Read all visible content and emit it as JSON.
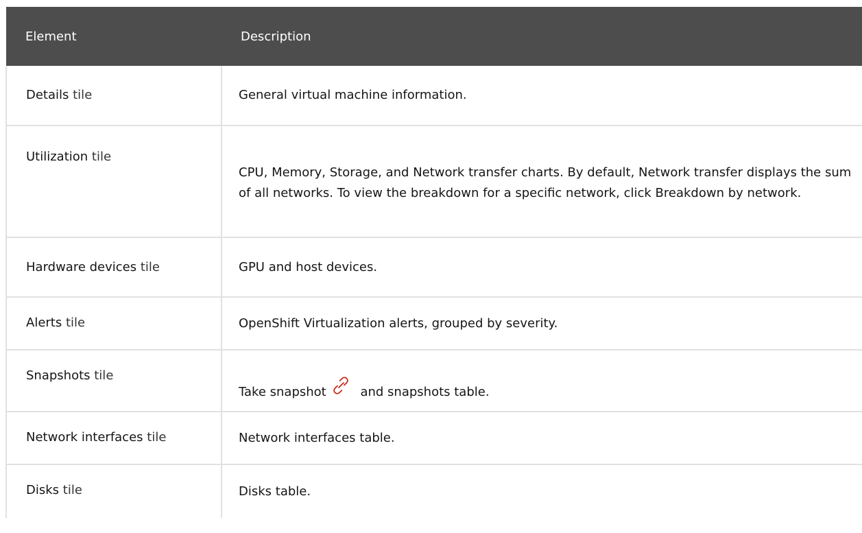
{
  "table": {
    "headers": [
      "Element",
      "Description"
    ],
    "rows": [
      {
        "name": "Details",
        "suffix": " tile",
        "desc": {
          "text": "General virtual machine information."
        }
      },
      {
        "name": "Utilization",
        "suffix": " tile",
        "desc": {
          "cpu": "CPU",
          "sep1": ", ",
          "memory": "Memory",
          "sep2": ", ",
          "storage": "Storage",
          "sep3": ", and ",
          "network_transfer": "Network transfer",
          "text1": " charts. By default, ",
          "network_transfer_2": "Network transfer",
          "text2": " displays the sum of all networks. To view the breakdown for a specific network, click ",
          "breakdown": "Breakdown by network",
          "text3": "."
        }
      },
      {
        "name": "Hardware devices",
        "suffix": " tile",
        "desc": {
          "text": "GPU and host devices."
        }
      },
      {
        "name": "Alerts",
        "suffix": " tile",
        "desc": {
          "text": "OpenShift Virtualization alerts, grouped by severity."
        }
      },
      {
        "name": "Snapshots",
        "suffix": " tile",
        "desc": {
          "take_snapshot": "Take snapshot",
          "icon": "link-icon",
          "text": " and snapshots table."
        }
      },
      {
        "name": "Network interfaces",
        "suffix": " tile",
        "desc": {
          "text": "Network interfaces table."
        }
      },
      {
        "name": "Disks",
        "suffix": " tile",
        "desc": {
          "text": "Disks table."
        }
      }
    ]
  },
  "colors": {
    "header_bg": "#4d4d4d",
    "border": "#e1e1e1",
    "link_icon": "#c9190b"
  }
}
